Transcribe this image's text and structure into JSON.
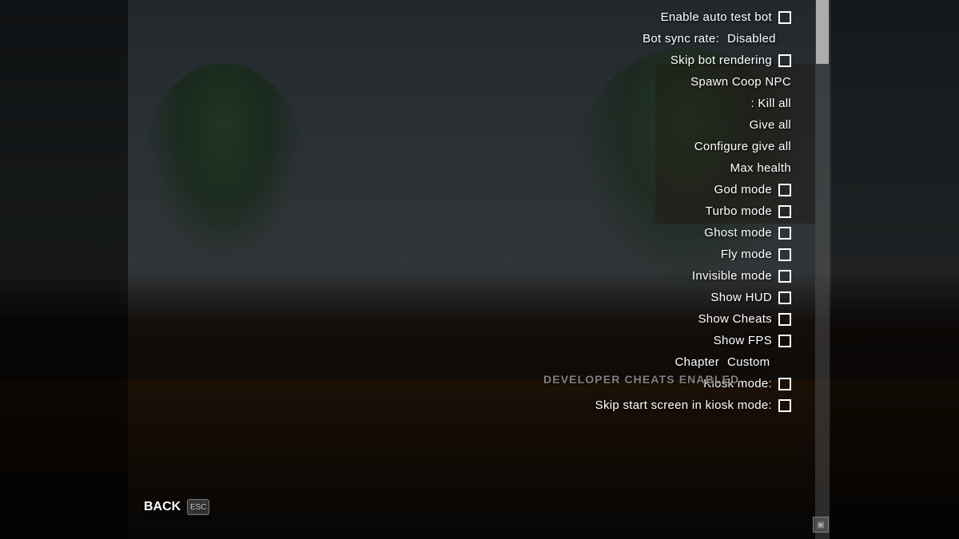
{
  "menu": {
    "items": [
      {
        "id": "enable-auto-test-bot",
        "label": "Enable auto test bot",
        "value_type": "checkbox",
        "checked": false
      },
      {
        "id": "bot-sync-rate",
        "label": "Bot sync rate:",
        "value_type": "text",
        "value": "Disabled"
      },
      {
        "id": "skip-bot-rendering",
        "label": "Skip bot rendering",
        "value_type": "checkbox",
        "checked": false
      },
      {
        "id": "spawn-coop-npc",
        "label": "Spawn Coop NPC",
        "value_type": "none"
      },
      {
        "id": "kill-all",
        "label": ": Kill all",
        "value_type": "none"
      },
      {
        "id": "give-all",
        "label": "Give all",
        "value_type": "none"
      },
      {
        "id": "configure-give-all",
        "label": "Configure give all",
        "value_type": "none"
      },
      {
        "id": "max-health",
        "label": "Max health",
        "value_type": "none"
      },
      {
        "id": "god-mode",
        "label": "God mode",
        "value_type": "checkbox",
        "checked": false
      },
      {
        "id": "turbo-mode",
        "label": "Turbo mode",
        "value_type": "checkbox",
        "checked": false
      },
      {
        "id": "ghost-mode",
        "label": "Ghost mode",
        "value_type": "checkbox",
        "checked": false
      },
      {
        "id": "fly-mode",
        "label": "Fly mode",
        "value_type": "checkbox",
        "checked": false
      },
      {
        "id": "invisible-mode",
        "label": "Invisible mode",
        "value_type": "checkbox",
        "checked": false
      },
      {
        "id": "show-hud",
        "label": "Show HUD",
        "value_type": "checkbox",
        "checked": false
      },
      {
        "id": "show-cheats",
        "label": "Show Cheats",
        "value_type": "checkbox",
        "checked": false
      },
      {
        "id": "show-fps",
        "label": "Show FPS",
        "value_type": "checkbox",
        "checked": false
      },
      {
        "id": "chapter",
        "label": "Chapter",
        "value_type": "text",
        "value": "Custom"
      },
      {
        "id": "kiosk-mode",
        "label": "Kiosk mode:",
        "value_type": "checkbox",
        "checked": false
      },
      {
        "id": "skip-start-screen",
        "label": "Skip start screen in kiosk mode:",
        "value_type": "checkbox",
        "checked": false
      }
    ],
    "dev_cheats_label": "DEVELOPER CHEATS ENABLED",
    "back_label": "BACK",
    "back_key": "ESC"
  }
}
